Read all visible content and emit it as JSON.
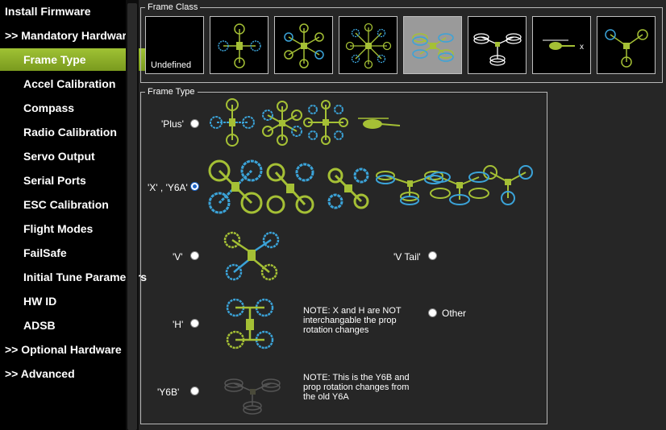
{
  "sidebar": {
    "items": [
      {
        "label": "Install Firmware",
        "kind": "top"
      },
      {
        "label": ">> Mandatory Hardware",
        "kind": "top"
      },
      {
        "label": "Frame Type",
        "kind": "sub",
        "active": true
      },
      {
        "label": "Accel Calibration",
        "kind": "sub"
      },
      {
        "label": "Compass",
        "kind": "sub"
      },
      {
        "label": "Radio Calibration",
        "kind": "sub"
      },
      {
        "label": "Servo Output",
        "kind": "sub"
      },
      {
        "label": "Serial Ports",
        "kind": "sub"
      },
      {
        "label": "ESC Calibration",
        "kind": "sub"
      },
      {
        "label": "Flight Modes",
        "kind": "sub"
      },
      {
        "label": "FailSafe",
        "kind": "sub"
      },
      {
        "label": "Initial Tune Parameters",
        "kind": "sub"
      },
      {
        "label": "HW ID",
        "kind": "sub"
      },
      {
        "label": "ADSB",
        "kind": "sub"
      },
      {
        "label": ">> Optional Hardware",
        "kind": "top"
      },
      {
        "label": ">> Advanced",
        "kind": "top"
      }
    ]
  },
  "frame_class": {
    "title": "Frame Class",
    "options": [
      {
        "label": "Undefined",
        "icon": "undefined-icon",
        "selected": false
      },
      {
        "label": "",
        "icon": "quad-icon",
        "selected": false
      },
      {
        "label": "",
        "icon": "hexa-icon",
        "selected": false
      },
      {
        "label": "",
        "icon": "octa-icon",
        "selected": false
      },
      {
        "label": "",
        "icon": "octaquad-icon",
        "selected": true
      },
      {
        "label": "",
        "icon": "y6-icon",
        "selected": false
      },
      {
        "label": "",
        "icon": "heli-icon",
        "selected": false
      },
      {
        "label": "",
        "icon": "tri-icon",
        "selected": false
      }
    ]
  },
  "frame_type": {
    "title": "Frame Type",
    "options": {
      "plus": {
        "label": "'Plus'",
        "checked": false
      },
      "x": {
        "label": "'X' , 'Y6A'",
        "checked": true
      },
      "v": {
        "label": "'V'",
        "checked": false
      },
      "vtail": {
        "label": "'V Tail'",
        "checked": false
      },
      "h": {
        "label": "'H'",
        "checked": false
      },
      "other": {
        "label": "Other",
        "checked": false
      },
      "y6b": {
        "label": "'Y6B'",
        "checked": false
      }
    },
    "notes": {
      "h_note": "NOTE: X and H are NOT interchangable the prop rotation changes",
      "y6b_note": "NOTE: This is the Y6B and prop rotation changes from the old Y6A"
    }
  },
  "colors": {
    "accent": "#9fc234",
    "prop_green": "#a5c035",
    "prop_blue": "#3ba3d8"
  }
}
